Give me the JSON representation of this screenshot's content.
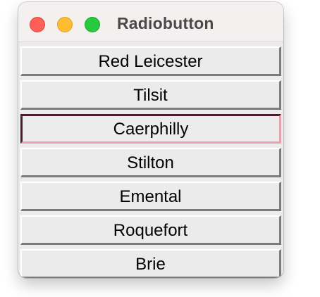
{
  "window": {
    "title": "Radiobutton"
  },
  "options": [
    {
      "label": "Red Leicester",
      "selected": false
    },
    {
      "label": "Tilsit",
      "selected": false
    },
    {
      "label": "Caerphilly",
      "selected": true
    },
    {
      "label": "Stilton",
      "selected": false
    },
    {
      "label": "Emental",
      "selected": false
    },
    {
      "label": "Roquefort",
      "selected": false
    },
    {
      "label": "Brie",
      "selected": false
    }
  ],
  "colors": {
    "close": "#fe5f57",
    "minimize": "#febc2e",
    "zoom": "#28c840",
    "selected_dark_edge": "#4b1d2b",
    "selected_light_edge": "#e7a0ad"
  }
}
